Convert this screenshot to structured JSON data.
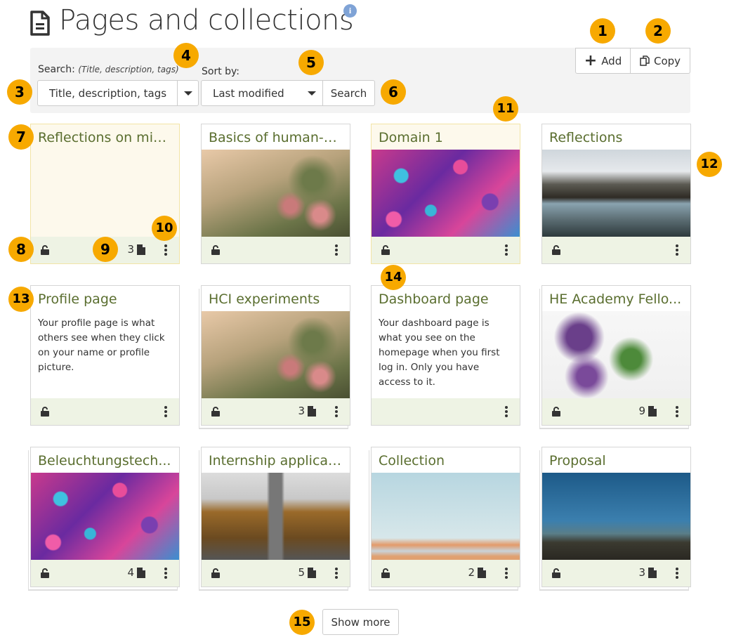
{
  "header": {
    "title": "Pages and collections",
    "page_icon": "file-text-icon",
    "info_icon": "info-icon"
  },
  "toolbar": {
    "add_label": "Add",
    "copy_label": "Copy"
  },
  "search": {
    "label": "Search:",
    "hint": "(Title, description, tags)",
    "selected": "Title, description, tags"
  },
  "sort": {
    "label": "Sort by:",
    "selected": "Last modified",
    "search_button": "Search"
  },
  "cards": [
    {
      "title": "Reflections on mic...",
      "style": "highlight",
      "count": "3",
      "collection": false
    },
    {
      "title": "Basics of human-c...",
      "image": "flowers",
      "count": "",
      "collection": false
    },
    {
      "title": "Domain 1",
      "style": "highlight",
      "image": "sprinkles",
      "count": "",
      "collection": false
    },
    {
      "title": "Reflections",
      "image": "mountains",
      "count": "",
      "collection": false
    },
    {
      "title": "Profile page",
      "description": "Your profile page is what others see when they click on your name or profile picture.",
      "count": "",
      "collection": false
    },
    {
      "title": "HCI experiments",
      "image": "flowers",
      "count": "3",
      "collection": true
    },
    {
      "title": "Dashboard page",
      "description": "Your dashboard page is what you see on the homepage when you first log in. Only you have access to it.",
      "count": "",
      "collection": false,
      "nolock": true
    },
    {
      "title": "HE Academy Fello...",
      "image": "lilac",
      "count": "9",
      "collection": true
    },
    {
      "title": "Beleuchtungstech...",
      "image": "sprinkles",
      "count": "4",
      "collection": true
    },
    {
      "title": "Internship applicat...",
      "image": "road",
      "count": "5",
      "collection": true
    },
    {
      "title": "Collection",
      "image": "sky",
      "count": "2",
      "collection": true
    },
    {
      "title": "Proposal",
      "image": "field",
      "count": "3",
      "collection": true
    }
  ],
  "show_more": "Show more",
  "badges": [
    "1",
    "2",
    "3",
    "4",
    "5",
    "6",
    "7",
    "8",
    "9",
    "10",
    "11",
    "12",
    "13",
    "14",
    "15"
  ],
  "colors": {
    "accent_badge": "#f7a900",
    "card_title": "#5a6e2f",
    "footer": "#eef3e4",
    "highlight": "#fdf9ec"
  }
}
